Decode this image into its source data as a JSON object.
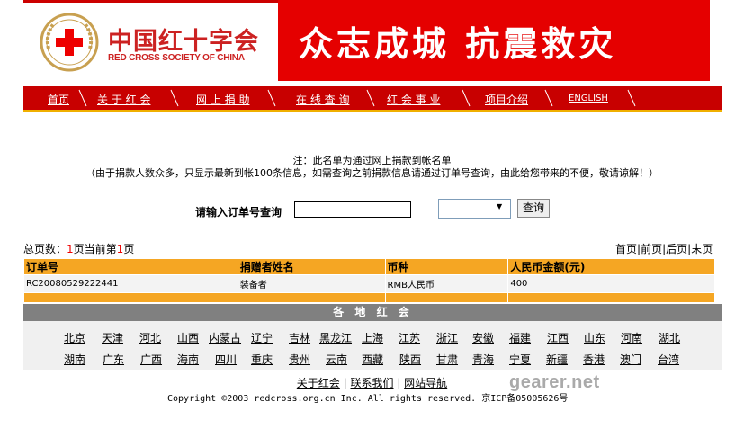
{
  "header": {
    "logo_cn": "中国红十字会",
    "logo_en": "RED CROSS SOCIETY OF CHINA",
    "banner": "众志成城  抗震救灾",
    "colors": {
      "brand_red": "#e50000",
      "nav_red": "#c80000",
      "accent_orange": "#f5a623"
    }
  },
  "nav": {
    "items": [
      "首页",
      "关 于 红 会",
      "网 上 捐 助",
      "在 线 查 询",
      "红 会 事 业",
      "项目介绍",
      "ENGLISH"
    ]
  },
  "notice": {
    "line1": "注：此名单为通过网上捐款到帐名单",
    "line2": "（由于捐款人数众多，只显示最新到帐100条信息，如需查询之前捐款信息请通过订单号查询，由此给您带来的不便，敬请谅解！）"
  },
  "search": {
    "label": "请输入订单号查询",
    "input_value": "",
    "select_value": "",
    "button": "查询"
  },
  "pager": {
    "total_prefix": "总页数：",
    "total_pages": "1",
    "mid": "页当前第",
    "current_page": "1",
    "suffix": "页",
    "links": [
      "首页",
      "前页",
      "后页",
      "末页"
    ]
  },
  "table": {
    "headers": [
      "订单号",
      "捐赠者姓名",
      "币种",
      "人民币金额(元)"
    ],
    "rows": [
      [
        "RC20080529222441",
        "装备者",
        "RMB人民币",
        "400"
      ]
    ]
  },
  "regions": {
    "title": "各 地 红 会",
    "row1": [
      "北京",
      "天津",
      "河北",
      "山西",
      "内蒙古",
      "辽宁",
      "吉林",
      "黑龙江",
      "上海",
      "江苏",
      "浙江",
      "安徽",
      "福建",
      "江西",
      "山东",
      "河南",
      "湖北"
    ],
    "row2": [
      "湖南",
      "广东",
      "广西",
      "海南",
      "四川",
      "重庆",
      "贵州",
      "云南",
      "西藏",
      "陕西",
      "甘肃",
      "青海",
      "宁夏",
      "新疆",
      "香港",
      "澳门",
      "台湾"
    ]
  },
  "footer": {
    "links": [
      "关于红会",
      "联系我们",
      "网站导航"
    ],
    "copyright": "Copyright ©2003 redcross.org.cn Inc. All rights reserved. 京ICP备05005626号",
    "watermark": "gearer.net"
  }
}
